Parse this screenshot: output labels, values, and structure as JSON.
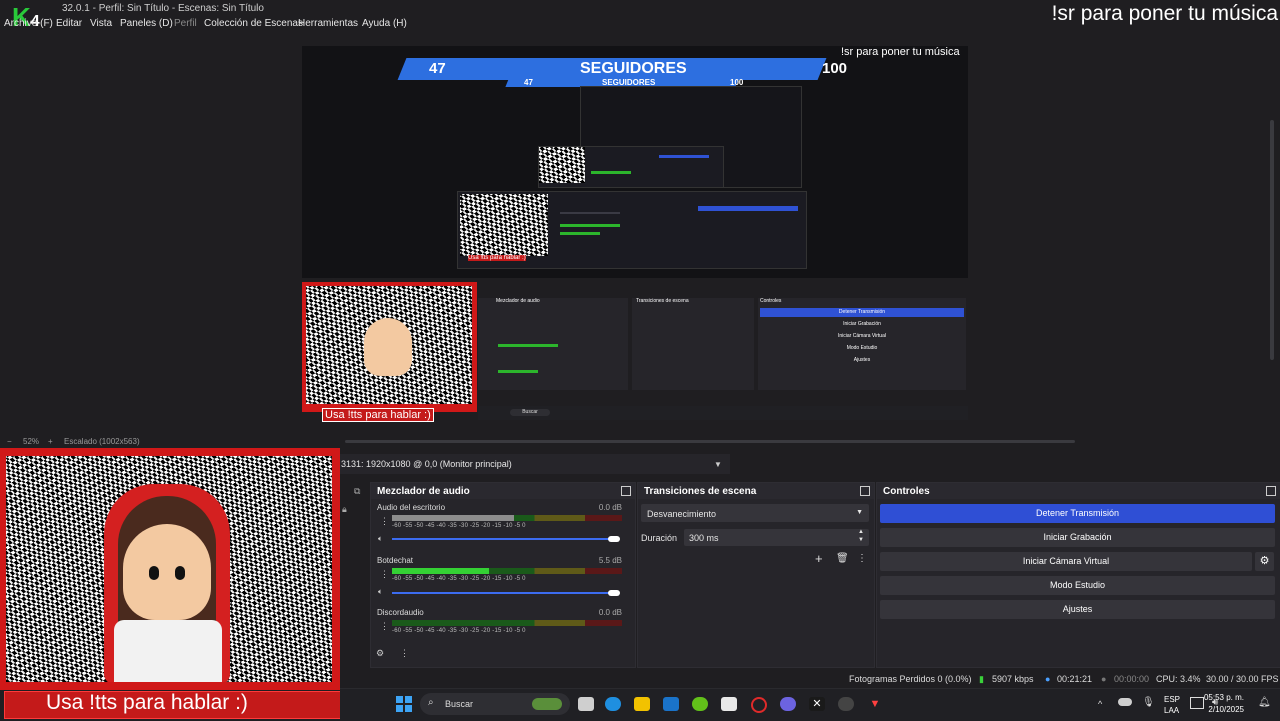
{
  "window": {
    "title": "32.0.1 - Perfil: Sin Título - Escenas: Sin Título",
    "overlay_music": "!sr para poner tu música",
    "logo_text": "K",
    "logo_number": "4"
  },
  "menu": [
    "Archivo (F)",
    "Editar",
    "Vista",
    "Paneles (D)",
    "Perfil",
    "Colección de Escenas",
    "Herramientas",
    "Ayuda (H)"
  ],
  "preview": {
    "followers_left": "47",
    "followers_label": "SEGUIDORES",
    "followers_goal": "100",
    "music_text": "!sr para poner tu música",
    "tts_text": "Usa !tts para hablar :)",
    "nested_labels": [
      "47",
      "SEGUIDORES",
      "100",
      "Usa !tts para hablar :)",
      "Mezclador de audio",
      "Transiciones de escena",
      "Controles",
      "Detener Transmisión",
      "Iniciar Grabación",
      "Iniciar Cámara Virtual",
      "Modo Estudio",
      "Ajustes",
      "Buscar"
    ]
  },
  "zoom": {
    "level": "52%",
    "scale_label": "Escalado (1002x563)"
  },
  "source_display": "3131: 1920x1080 @ 0,0 (Monitor principal)",
  "mixer": {
    "title": "Mezclador de audio",
    "channels": [
      {
        "name": "Audio del escritorio",
        "db": "0.0 dB",
        "level": 0.53,
        "color": "gray"
      },
      {
        "name": "Botdechat",
        "db": "5.5 dB",
        "level": 0.42,
        "color": "green"
      },
      {
        "name": "Discordaudio",
        "db": "0.0 dB",
        "level": 0.0,
        "color": "green"
      }
    ],
    "ticks": "-60  -55  -50  -45  -40  -35  -30  -25  -20  -15  -10  -5  0"
  },
  "transitions": {
    "title": "Transiciones de escena",
    "selected": "Desvanecimiento",
    "duration_label": "Duración",
    "duration_value": "300 ms"
  },
  "controls": {
    "title": "Controles",
    "buttons": [
      "Detener Transmisión",
      "Iniciar Grabación",
      "Iniciar Cámara Virtual",
      "Modo Estudio",
      "Ajustes"
    ]
  },
  "status": {
    "dropped_frames": "Fotogramas Perdidos 0 (0.0%)",
    "bitrate": "5907 kbps",
    "stream_time": "00:21:21",
    "record_time": "00:00:00",
    "cpu": "CPU: 3.4%",
    "fps": "30.00 / 30.00 FPS"
  },
  "taskbar": {
    "search": "Buscar",
    "lang1": "ESP",
    "lang2": "LAA",
    "time": "05:53 p. m.",
    "date": "2/10/2025"
  },
  "webcam": {
    "tts_text": "Usa !tts para hablar :)"
  },
  "colors": {
    "accent": "#2f4fd5",
    "banner": "#2d6fe0",
    "webcam_border": "#d01818",
    "meter_green": "#34d134"
  }
}
